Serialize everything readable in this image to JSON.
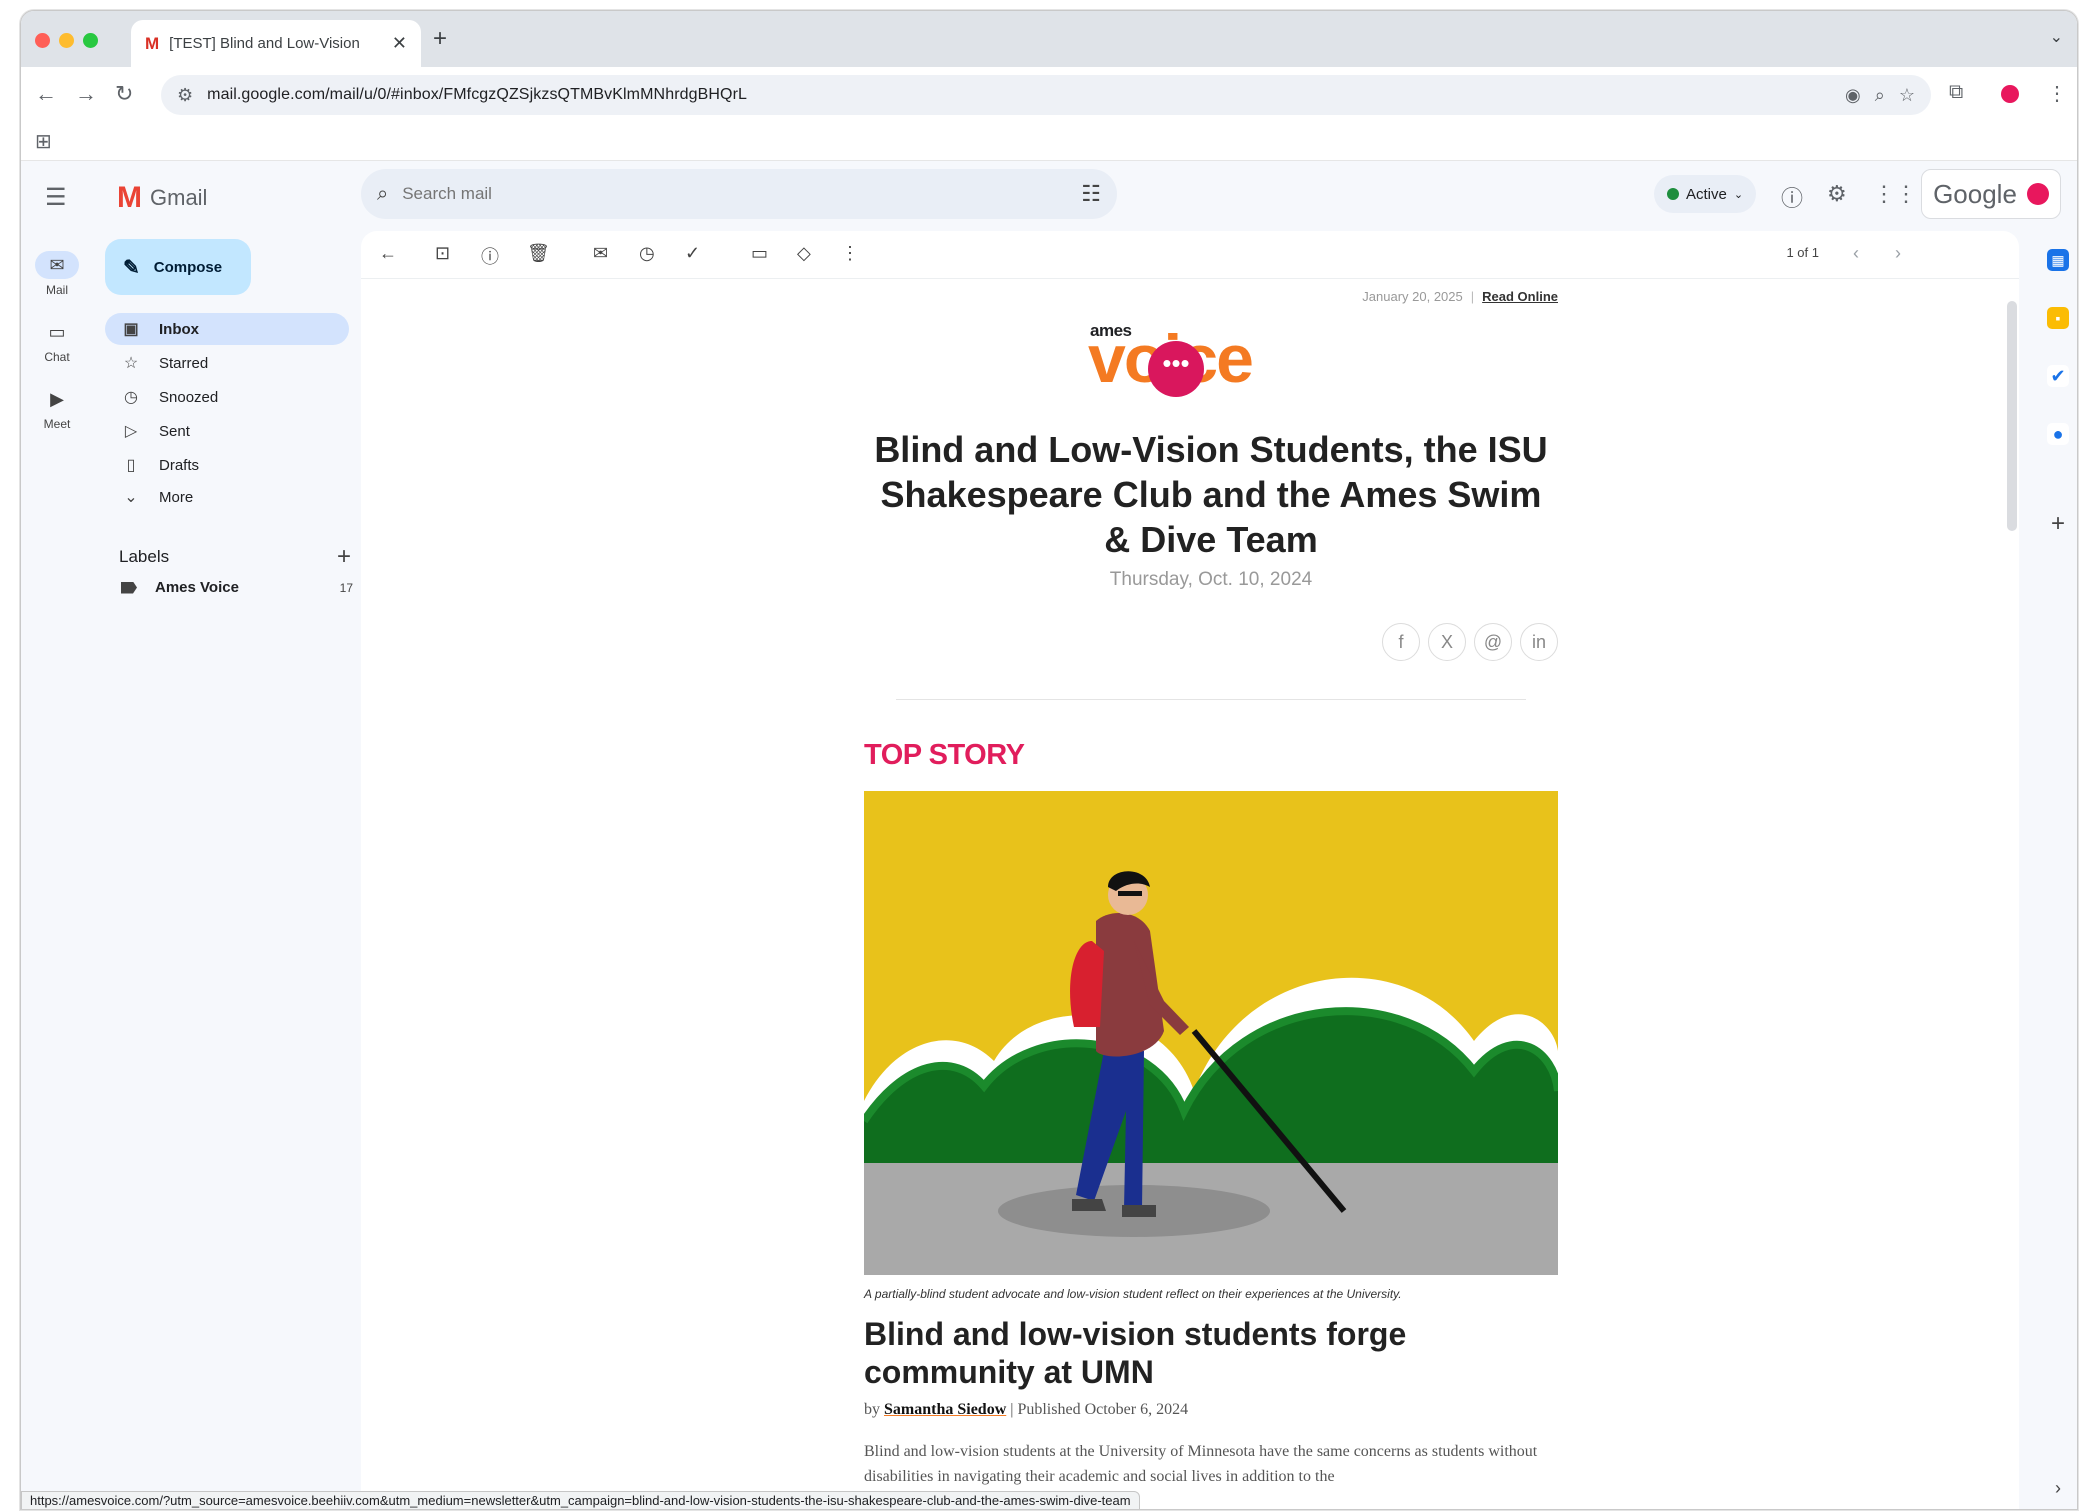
{
  "browser": {
    "tab_title": "[TEST] Blind and Low-Vision",
    "new_tab": "+",
    "url": "mail.google.com/mail/u/0/#inbox/FMfcgzQZSjkzsQTMBvKlmMNhrdgBHQrL",
    "status_url": "https://amesvoice.com/?utm_source=amesvoice.beehiiv.com&utm_medium=newsletter&utm_campaign=blind-and-low-vision-students-the-isu-shakespeare-club-and-the-ames-swim-dive-team"
  },
  "gmail": {
    "product": "Gmail",
    "search_placeholder": "Search mail",
    "status": "Active",
    "account_brand": "Google",
    "compose": "Compose",
    "rail": [
      {
        "label": "Mail",
        "icon": "mail-icon"
      },
      {
        "label": "Chat",
        "icon": "chat-icon"
      },
      {
        "label": "Meet",
        "icon": "video-icon"
      }
    ],
    "folders": [
      {
        "label": "Inbox",
        "icon": "inbox-icon"
      },
      {
        "label": "Starred",
        "icon": "star-icon"
      },
      {
        "label": "Snoozed",
        "icon": "clock-icon"
      },
      {
        "label": "Sent",
        "icon": "send-icon"
      },
      {
        "label": "Drafts",
        "icon": "draft-icon"
      },
      {
        "label": "More",
        "icon": "chevron-down-icon"
      }
    ],
    "labels_heading": "Labels",
    "labels": [
      {
        "name": "Ames Voice",
        "count": "17"
      }
    ],
    "pager": "1 of 1"
  },
  "newsletter": {
    "issue_date": "January 20, 2025",
    "read_online": "Read Online",
    "brand_small": "ames",
    "brand_big": "voice",
    "headline": "Blind and Low-Vision Students, the ISU Shakespeare Club and the Ames Swim & Dive Team",
    "date": "Thursday, Oct. 10, 2024",
    "share": [
      "f",
      "X",
      "@",
      "in"
    ],
    "section": "TOP STORY",
    "caption": "A partially-blind student advocate and low-vision student reflect on their experiences at the University.",
    "story_title": "Blind and low-vision students forge community at UMN",
    "by_prefix": "by",
    "author": "Samantha Siedow",
    "published": "| Published October 6, 2024",
    "body": "Blind and low-vision students at the University of Minnesota have the same concerns as students without disabilities in navigating their academic and social lives in addition to the"
  },
  "colors": {
    "accent_pink": "#e11d5c",
    "brand_orange": "#f47a22",
    "compose_bg": "#c2e7ff",
    "selected_bg": "#d3e3fd"
  }
}
